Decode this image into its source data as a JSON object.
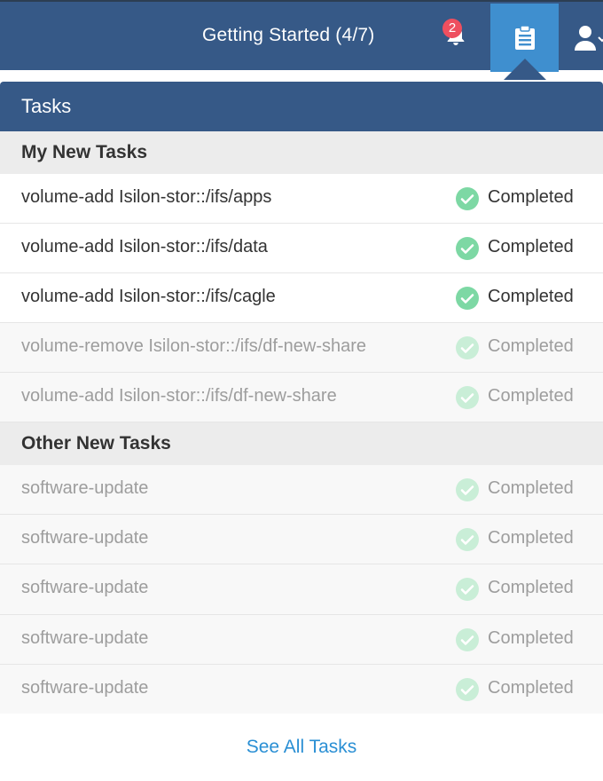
{
  "header": {
    "getting_started": "Getting Started (4/7)",
    "notification_count": "2",
    "icons": {
      "bell": "bell-icon",
      "tasks": "clipboard-icon",
      "user": "user-icon"
    },
    "colors": {
      "bar": "#365987",
      "active_tab": "#3f8fcf",
      "badge": "#ee4f5f"
    }
  },
  "panel": {
    "title": "Tasks",
    "sections": [
      {
        "title": "My New Tasks",
        "tasks": [
          {
            "name": "volume-add Isilon-stor::/ifs/apps",
            "status": "Completed",
            "state": "new"
          },
          {
            "name": "volume-add Isilon-stor::/ifs/data",
            "status": "Completed",
            "state": "new"
          },
          {
            "name": "volume-add Isilon-stor::/ifs/cagle",
            "status": "Completed",
            "state": "new"
          },
          {
            "name": "volume-remove Isilon-stor::/ifs/df-new-share",
            "status": "Completed",
            "state": "seen"
          },
          {
            "name": "volume-add Isilon-stor::/ifs/df-new-share",
            "status": "Completed",
            "state": "seen"
          }
        ]
      },
      {
        "title": "Other New Tasks",
        "tasks": [
          {
            "name": "software-update",
            "status": "Completed",
            "state": "seen"
          },
          {
            "name": "software-update",
            "status": "Completed",
            "state": "seen"
          },
          {
            "name": "software-update",
            "status": "Completed",
            "state": "seen"
          },
          {
            "name": "software-update",
            "status": "Completed",
            "state": "seen"
          },
          {
            "name": "software-update",
            "status": "Completed",
            "state": "seen"
          }
        ]
      }
    ],
    "see_all": "See All Tasks",
    "colors": {
      "check_active": "#7dd8a4",
      "check_inactive": "#c9eed7",
      "link": "#2a8fd4"
    }
  }
}
